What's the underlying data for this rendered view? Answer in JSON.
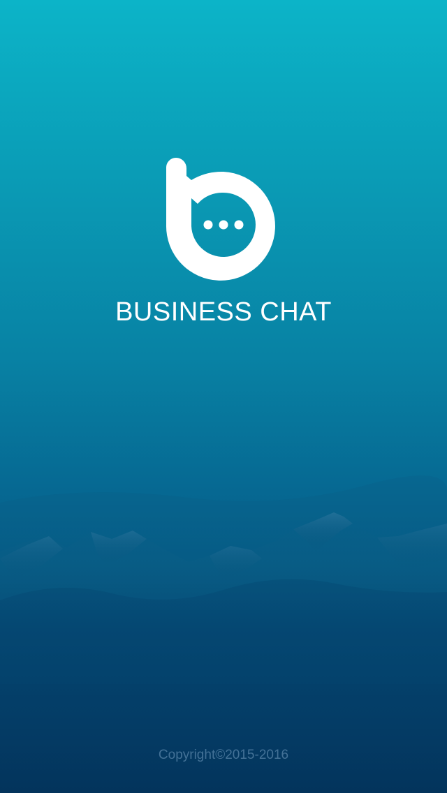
{
  "splash": {
    "app_name": "BUSINESS CHAT",
    "copyright": "Copyright©2015-2016",
    "logo_icon": "b-chat-bubble-logo-icon",
    "background_icon": "mountain-landscape"
  },
  "colors": {
    "gradient_top": "#0cb4c8",
    "gradient_bottom": "#03345c",
    "logo": "#ffffff",
    "title": "#ffffff",
    "copyright": "#4f7fa6"
  }
}
